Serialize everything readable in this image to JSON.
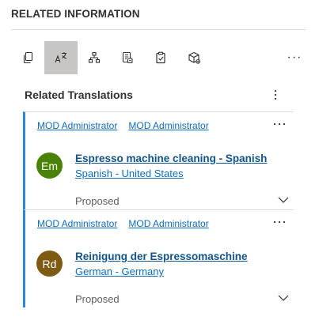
{
  "panel": {
    "title": "RELATED INFORMATION"
  },
  "toolbar": {
    "tabs": [
      {
        "icon": "copy-icon",
        "active": false
      },
      {
        "icon": "translate-icon",
        "active": true
      },
      {
        "icon": "hierarchy-icon",
        "active": false
      },
      {
        "icon": "document-list-icon",
        "active": false
      },
      {
        "icon": "clipboard-check-icon",
        "active": false
      },
      {
        "icon": "product-box-icon",
        "active": false
      }
    ],
    "more_label": "···"
  },
  "section": {
    "title": "Related Translations"
  },
  "cards": [
    {
      "owner1": "MOD Administrator",
      "owner2": "MOD Administrator",
      "avatar_initials": "Em",
      "avatar_color": "#498205",
      "title": "Espresso machine cleaning - Spanish",
      "language": "Spanish - United States",
      "status": "Proposed",
      "more_label": "···"
    },
    {
      "owner1": "MOD Administrator",
      "owner2": "MOD Administrator",
      "avatar_initials": "Rd",
      "avatar_color": "#7f5a12",
      "title": "Reinigung der Espressomaschine",
      "language": "German - Germany",
      "status": "Proposed",
      "more_label": "···"
    }
  ],
  "colors": {
    "accent": "#2b88d8",
    "link": "#0f6cbd",
    "active_tab_bg": "#c8c6c4"
  }
}
